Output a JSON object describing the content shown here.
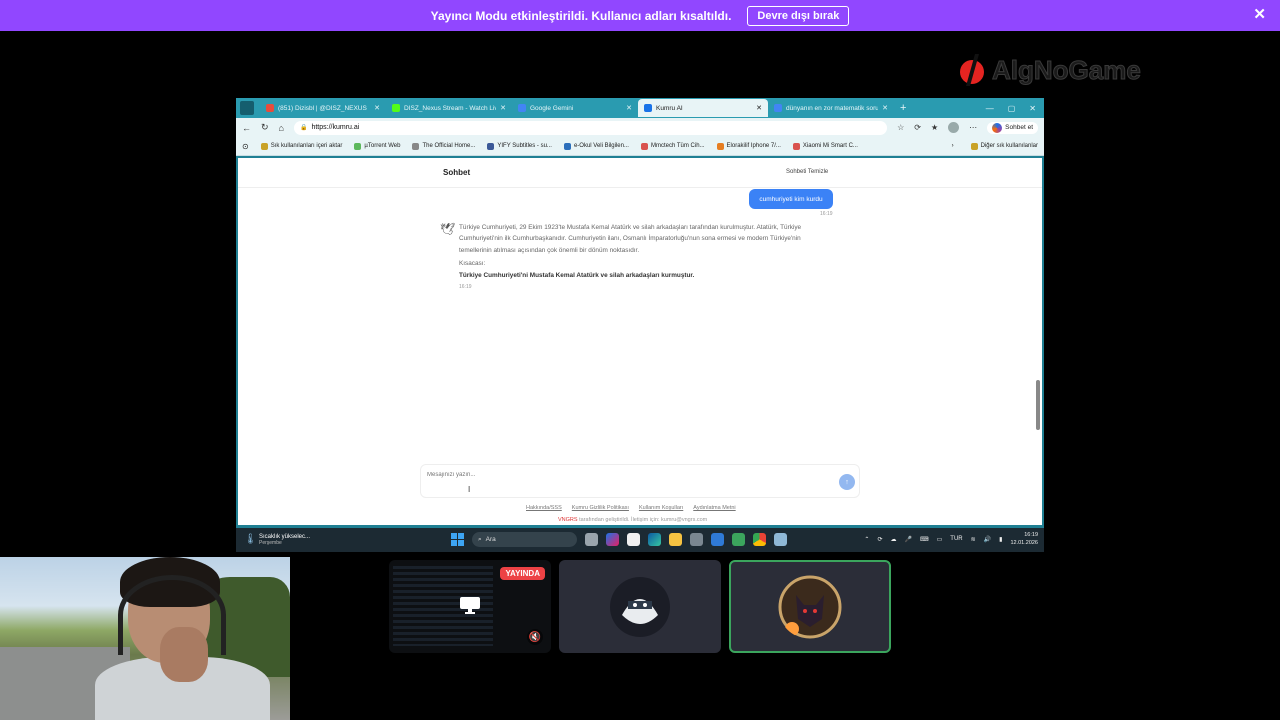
{
  "banner": {
    "text": "Yayıncı Modu etkinleştirildi. Kullanıcı adları kısaltıldı.",
    "button": "Devre dışı bırak",
    "close_icon": "close-icon",
    "color": "#9147ff"
  },
  "watermark": {
    "text": "AlgNoGame"
  },
  "browser": {
    "tabs": [
      {
        "label": "(851) Dizisbl | @DISZ_NEXUS",
        "icon_color": "#e74c3c"
      },
      {
        "label": "DISZ_Nexus Stream - Watch Live",
        "icon_color": "#53fc18"
      },
      {
        "label": "Google Gemini",
        "icon_color": "#4285f4"
      },
      {
        "label": "Kumru AI",
        "icon_color": "#1a73e8"
      },
      {
        "label": "dünyanın en zor matematik sorusu A",
        "icon_color": "#4285f4"
      }
    ],
    "url": "https://kumru.ai",
    "sohbet_chip": "Sohbet et",
    "bookmarks": [
      "Sık kullanılanları içeri aktar",
      "µTorrent Web",
      "The Official Home...",
      "YIFY Subtitles - su...",
      "e-Okul Veli Bilgilen...",
      "Mmctech Tüm Cih...",
      "Elorakilif Iphone 7/...",
      "Xiaomi Mi Smart C..."
    ],
    "bookmarks_other": "Diğer sık kullanılanlar"
  },
  "chat": {
    "title": "Sohbet",
    "clear_label": "Sohbeti Temizle",
    "user_message": "cumhuriyeti kim kurdu",
    "user_time": "16:19",
    "bot_message": "Türkiye Cumhuriyeti, 29 Ekim 1923'te Mustafa Kemal Atatürk ve silah arkadaşları tarafından kurulmuştur. Atatürk, Türkiye Cumhuriyeti'nin ilk Cumhurbaşkanıdır. Cumhuriyetin ilanı, Osmanlı İmparatorluğu'nun sona ermesi ve modern Türkiye'nin temellerinin atılması açısından çok önemli bir dönüm noktasıdır.",
    "summary_label": "Kısacası:",
    "summary": "Türkiye Cumhuriyeti'ni Mustafa Kemal Atatürk ve silah arkadaşları kurmuştur.",
    "bot_time": "16:19",
    "input_placeholder": "Mesajınızı yazın...",
    "footer_links": [
      "Hakkında/SSS",
      "Kumru Gizlilik Politikası",
      "Kullanım Koşulları",
      "Aydınlatma Metni"
    ],
    "footer_brand": "VNGRS",
    "footer_credit": " tarafından geliştirildi. İletişim için: kumru@vngrs.com"
  },
  "taskbar": {
    "weather_title": "Sıcaklık yükselec...",
    "weather_day": "Perşembe",
    "search": "Ara",
    "lang": "TUR",
    "time": "16:19",
    "date": "12.01.2026"
  },
  "discord": {
    "live_badge": "YAYINDA",
    "live_color": "#ed4245",
    "speaking_color": "#3ba55d"
  }
}
